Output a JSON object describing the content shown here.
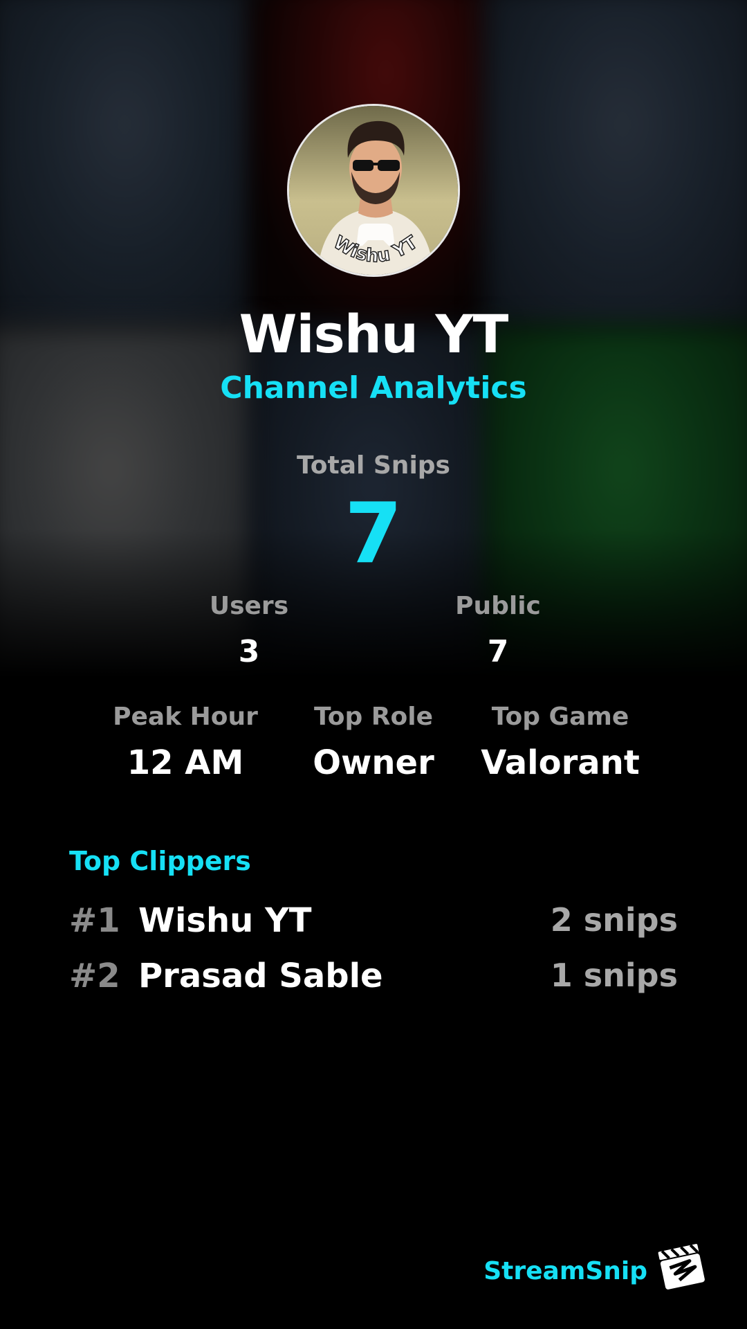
{
  "background": {
    "tile_colors": [
      "#24303e",
      "#3a0808",
      "#253140",
      "#4a4d50",
      "#1f2937",
      "#0f4a1c"
    ]
  },
  "avatar": {
    "icon": "avatar-cartoon-icon",
    "watermark": "Wishu YT"
  },
  "channel": {
    "name": "Wishu YT",
    "subtitle": "Channel Analytics"
  },
  "stats": {
    "total_label": "Total Snips",
    "total_value": "7",
    "users_label": "Users",
    "users_value": "3",
    "public_label": "Public",
    "public_value": "7",
    "peak_hour_label": "Peak Hour",
    "peak_hour_value": "12 AM",
    "top_role_label": "Top Role",
    "top_role_value": "Owner",
    "top_game_label": "Top Game",
    "top_game_value": "Valorant"
  },
  "clippers": {
    "title": "Top Clippers",
    "items": [
      {
        "rank": "#1",
        "name": "Wishu YT",
        "count": "2 snips"
      },
      {
        "rank": "#2",
        "name": "Prasad Sable",
        "count": "1 snips"
      }
    ]
  },
  "brand": {
    "name": "StreamSnip",
    "icon": "clapperboard-icon"
  },
  "colors": {
    "accent": "#16e0f5",
    "muted": "#9b9b9b",
    "background": "#000000"
  }
}
